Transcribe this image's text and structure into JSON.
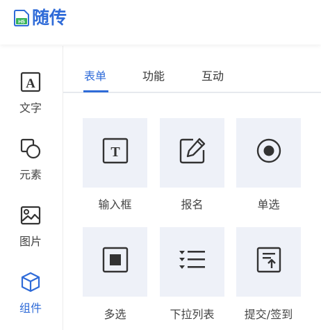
{
  "app": {
    "logo_text": "随传",
    "logo_badge": "H5"
  },
  "sidebar": {
    "items": [
      {
        "label": "文字",
        "icon": "text-icon"
      },
      {
        "label": "元素",
        "icon": "shapes-icon"
      },
      {
        "label": "图片",
        "icon": "image-icon"
      },
      {
        "label": "组件",
        "icon": "cube-icon",
        "active": true
      }
    ]
  },
  "tabs": [
    {
      "label": "表单",
      "active": true
    },
    {
      "label": "功能"
    },
    {
      "label": "互动"
    }
  ],
  "components": [
    {
      "label": "输入框",
      "icon": "text-input-icon"
    },
    {
      "label": "报名",
      "icon": "edit-icon"
    },
    {
      "label": "单选",
      "icon": "radio-icon"
    },
    {
      "label": "多选",
      "icon": "checkbox-icon"
    },
    {
      "label": "下拉列表",
      "icon": "dropdown-list-icon"
    },
    {
      "label": "提交/签到",
      "icon": "submit-icon"
    }
  ],
  "colors": {
    "accent": "#2f6bd8",
    "tile_bg": "#eef1f8",
    "icon": "#333333"
  }
}
